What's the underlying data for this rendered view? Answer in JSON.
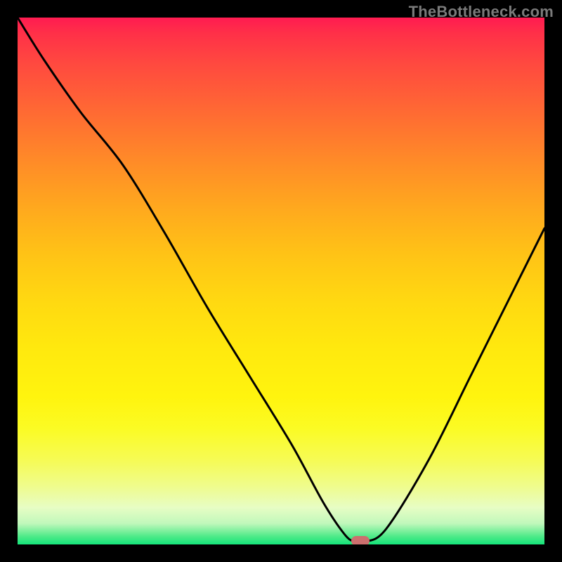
{
  "watermark": "TheBottleneck.com",
  "colors": {
    "background": "#000000",
    "curve_stroke": "#000000",
    "marker_fill": "#cc6f6e",
    "watermark_text": "#7a7a7a",
    "gradient_top": "#ff1b51",
    "gradient_mid": "#ffe90e",
    "gradient_bottom": "#15e47a"
  },
  "chart_data": {
    "type": "line",
    "title": "",
    "xlabel": "",
    "ylabel": "",
    "xlim": [
      0,
      100
    ],
    "ylim": [
      0,
      100
    ],
    "series": [
      {
        "name": "bottleneck-curve",
        "x": [
          0,
          5,
          12,
          20,
          28,
          36,
          44,
          52,
          58,
          62,
          64,
          66,
          70,
          78,
          86,
          94,
          100
        ],
        "y": [
          100,
          92,
          82,
          72,
          59,
          45,
          32,
          19,
          8,
          2,
          0.5,
          0.5,
          3,
          16,
          32,
          48,
          60
        ]
      }
    ],
    "marker": {
      "x": 65,
      "y": 0.7
    },
    "background_gradient": {
      "direction": "vertical",
      "stops": [
        {
          "pos": 0.0,
          "color": "#ff1b51"
        },
        {
          "pos": 0.27,
          "color": "#ff8a28"
        },
        {
          "pos": 0.54,
          "color": "#ffd911"
        },
        {
          "pos": 0.78,
          "color": "#fbfb24"
        },
        {
          "pos": 0.93,
          "color": "#e7fdc4"
        },
        {
          "pos": 1.0,
          "color": "#15e47a"
        }
      ]
    }
  }
}
